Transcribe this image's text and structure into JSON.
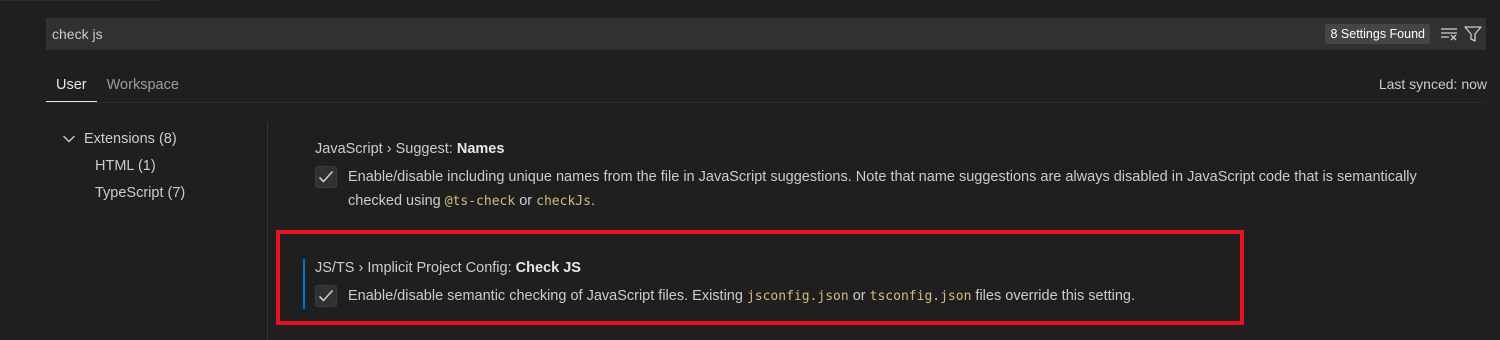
{
  "search": {
    "value": "check js",
    "result_count": "8 Settings Found",
    "clear_filter_icon": "clear-filter-icon",
    "filter_icon": "filter-icon"
  },
  "tabs": [
    {
      "label": "User",
      "active": true
    },
    {
      "label": "Workspace",
      "active": false
    }
  ],
  "sync_status": "Last synced: now",
  "toc": {
    "group_label": "Extensions (8)",
    "children": [
      "HTML (1)",
      "TypeScript (7)"
    ]
  },
  "settings": [
    {
      "category": "JavaScript › Suggest: ",
      "name": "Names",
      "checked": true,
      "desc_before": "Enable/disable including unique names from the file in JavaScript suggestions. Note that name suggestions are always disabled in JavaScript code that is semantically checked using ",
      "code1": "@ts-check",
      "desc_mid": " or ",
      "code2": "checkJs",
      "desc_after": "."
    },
    {
      "category": "JS/TS › Implicit Project Config: ",
      "name": "Check JS",
      "checked": true,
      "desc_before": "Enable/disable semantic checking of JavaScript files. Existing ",
      "code1": "jsconfig.json",
      "desc_mid": " or ",
      "code2": "tsconfig.json",
      "desc_after": " files override this setting."
    }
  ],
  "colors": {
    "accent": "#0078d4",
    "highlight": "#e81123",
    "code": "#d7ba7d"
  }
}
